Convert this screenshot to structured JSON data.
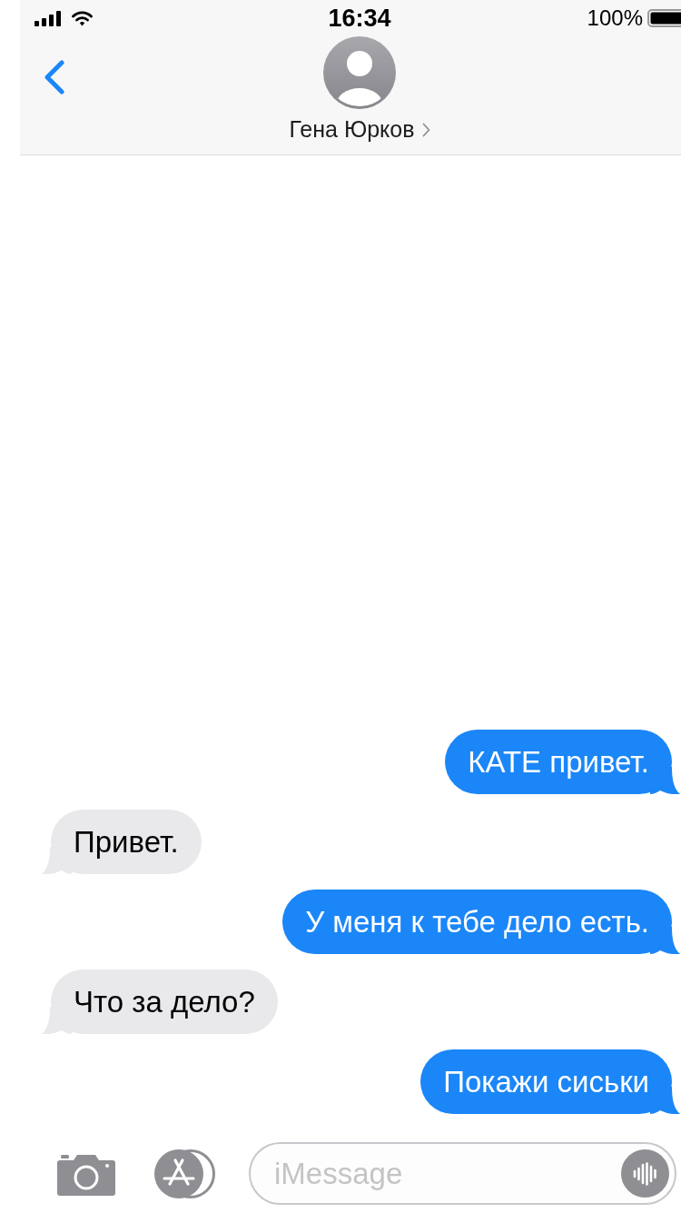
{
  "status_bar": {
    "time": "16:34",
    "battery": "100%"
  },
  "header": {
    "contact_name": "Гена Юрков"
  },
  "messages": [
    {
      "kind": "outgoing",
      "text": "КАТЕ привет."
    },
    {
      "kind": "incoming",
      "text": "Привет."
    },
    {
      "kind": "outgoing",
      "text": "У меня к тебе дело есть."
    },
    {
      "kind": "incoming",
      "text": "Что за дело?"
    },
    {
      "kind": "outgoing",
      "text": "Покажи сиськи"
    }
  ],
  "composer": {
    "placeholder": "iMessage"
  }
}
